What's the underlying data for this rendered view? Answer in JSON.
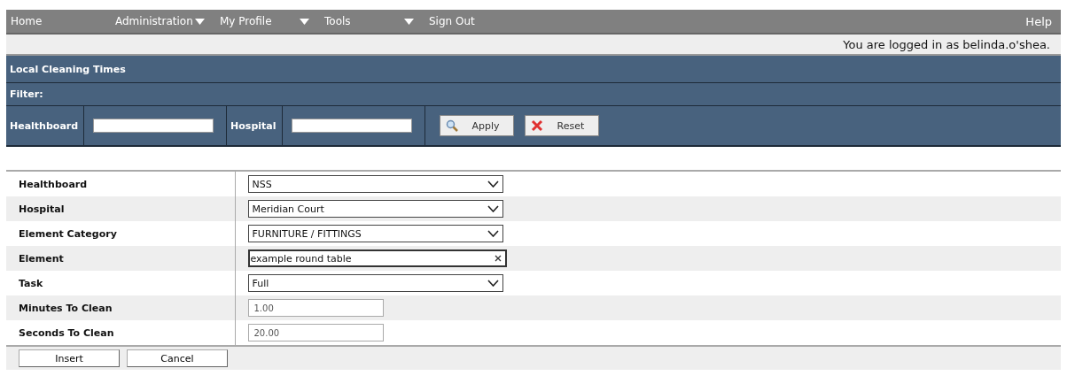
{
  "nav": {
    "items": [
      {
        "label": "Home",
        "dropdown": false
      },
      {
        "label": "Administration",
        "dropdown": true
      },
      {
        "label": "My Profile",
        "dropdown": true
      },
      {
        "label": "Tools",
        "dropdown": true
      },
      {
        "label": "Sign Out",
        "dropdown": false
      }
    ],
    "help": "Help"
  },
  "login_status": "You are logged in as belinda.o'shea.",
  "panel": {
    "title": "Local Cleaning Times",
    "filter_label": "Filter:",
    "filters": [
      {
        "label": "Healthboard"
      },
      {
        "label": "Hospital"
      }
    ],
    "buttons": [
      {
        "label": "Apply",
        "kind": "search"
      },
      {
        "label": "Reset",
        "kind": "clear"
      }
    ]
  },
  "form": {
    "rows": [
      {
        "label": "Healthboard",
        "kind": "select",
        "value": "NSS"
      },
      {
        "label": "Hospital",
        "kind": "select",
        "value": "Meridian Court"
      },
      {
        "label": "Element Category",
        "kind": "select",
        "value": "FURNITURE / FITTINGS"
      },
      {
        "label": "Element",
        "kind": "search",
        "value": "example round table"
      },
      {
        "label": "Task",
        "kind": "select",
        "value": "Full"
      },
      {
        "label": "Minutes To Clean",
        "kind": "text",
        "value": "1.00"
      },
      {
        "label": "Seconds To Clean",
        "kind": "text",
        "value": "20.00"
      }
    ],
    "buttons": [
      "Insert",
      "Cancel"
    ]
  }
}
